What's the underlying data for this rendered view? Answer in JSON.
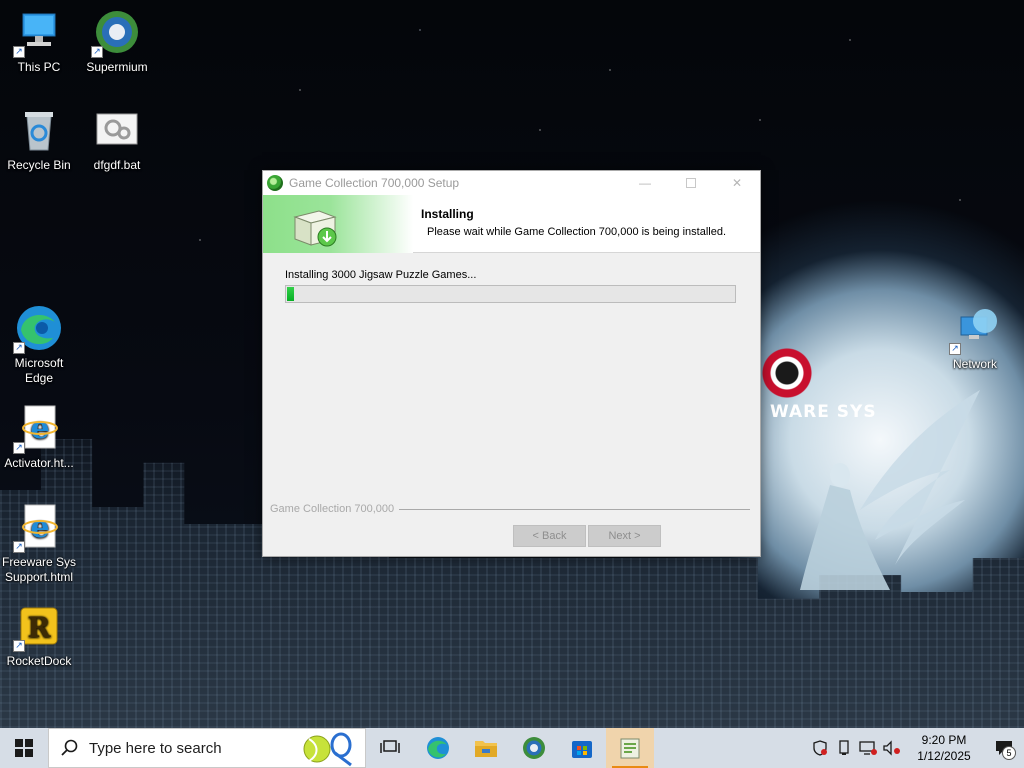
{
  "desktop": {
    "icons": [
      {
        "label": "This PC"
      },
      {
        "label": "Supermium"
      },
      {
        "label": "Recycle Bin"
      },
      {
        "label": "dfgdf.bat"
      },
      {
        "label": "Microsoft Edge"
      },
      {
        "label": "Activator.ht..."
      },
      {
        "label": "Freeware Sys Support.html"
      },
      {
        "label": "RocketDock"
      },
      {
        "label": "Network"
      }
    ],
    "wallpaper_logo_text": "WARE SYS"
  },
  "setup": {
    "window_title": "Game Collection 700,000 Setup",
    "header_title": "Installing",
    "header_subtitle": "Please wait while Game Collection 700,000 is being installed.",
    "status_text": "Installing 3000 Jigsaw Puzzle Games...",
    "progress_fraction": 0.016,
    "brand_text": "Game Collection 700,000",
    "back_label": "< Back",
    "next_label": "Next >",
    "accent_color": "#06b025"
  },
  "taskbar": {
    "search_placeholder": "Type here to search",
    "apps": [
      "task-view",
      "edge",
      "file-explorer",
      "supermium",
      "microsoft-store",
      "setup-installer"
    ],
    "clock_time": "9:20 PM",
    "clock_date": "1/12/2025",
    "notification_count": "5"
  }
}
